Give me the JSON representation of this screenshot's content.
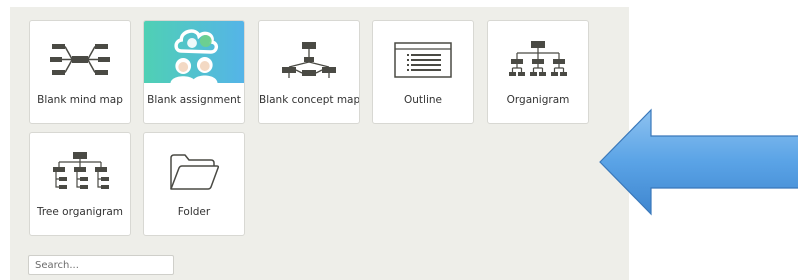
{
  "templates": [
    {
      "label": "Blank mind map",
      "icon": "mind-map-icon"
    },
    {
      "label": "Blank assignment",
      "icon": "assignment-thumbnail"
    },
    {
      "label": "Blank concept map",
      "icon": "concept-map-icon"
    },
    {
      "label": "Outline",
      "icon": "outline-icon"
    },
    {
      "label": "Organigram",
      "icon": "organigram-icon"
    },
    {
      "label": "Tree organigram",
      "icon": "tree-organigram-icon"
    },
    {
      "label": "Folder",
      "icon": "folder-icon"
    }
  ],
  "search": {
    "placeholder": "Search..."
  },
  "colors": {
    "panel_bg": "#eeeee9",
    "icon_dark": "#4a4a44",
    "assignment_bg_start": "#4fd0b4",
    "assignment_bg_end": "#55b4e8",
    "arrow_fill": "#5aa3e6"
  }
}
